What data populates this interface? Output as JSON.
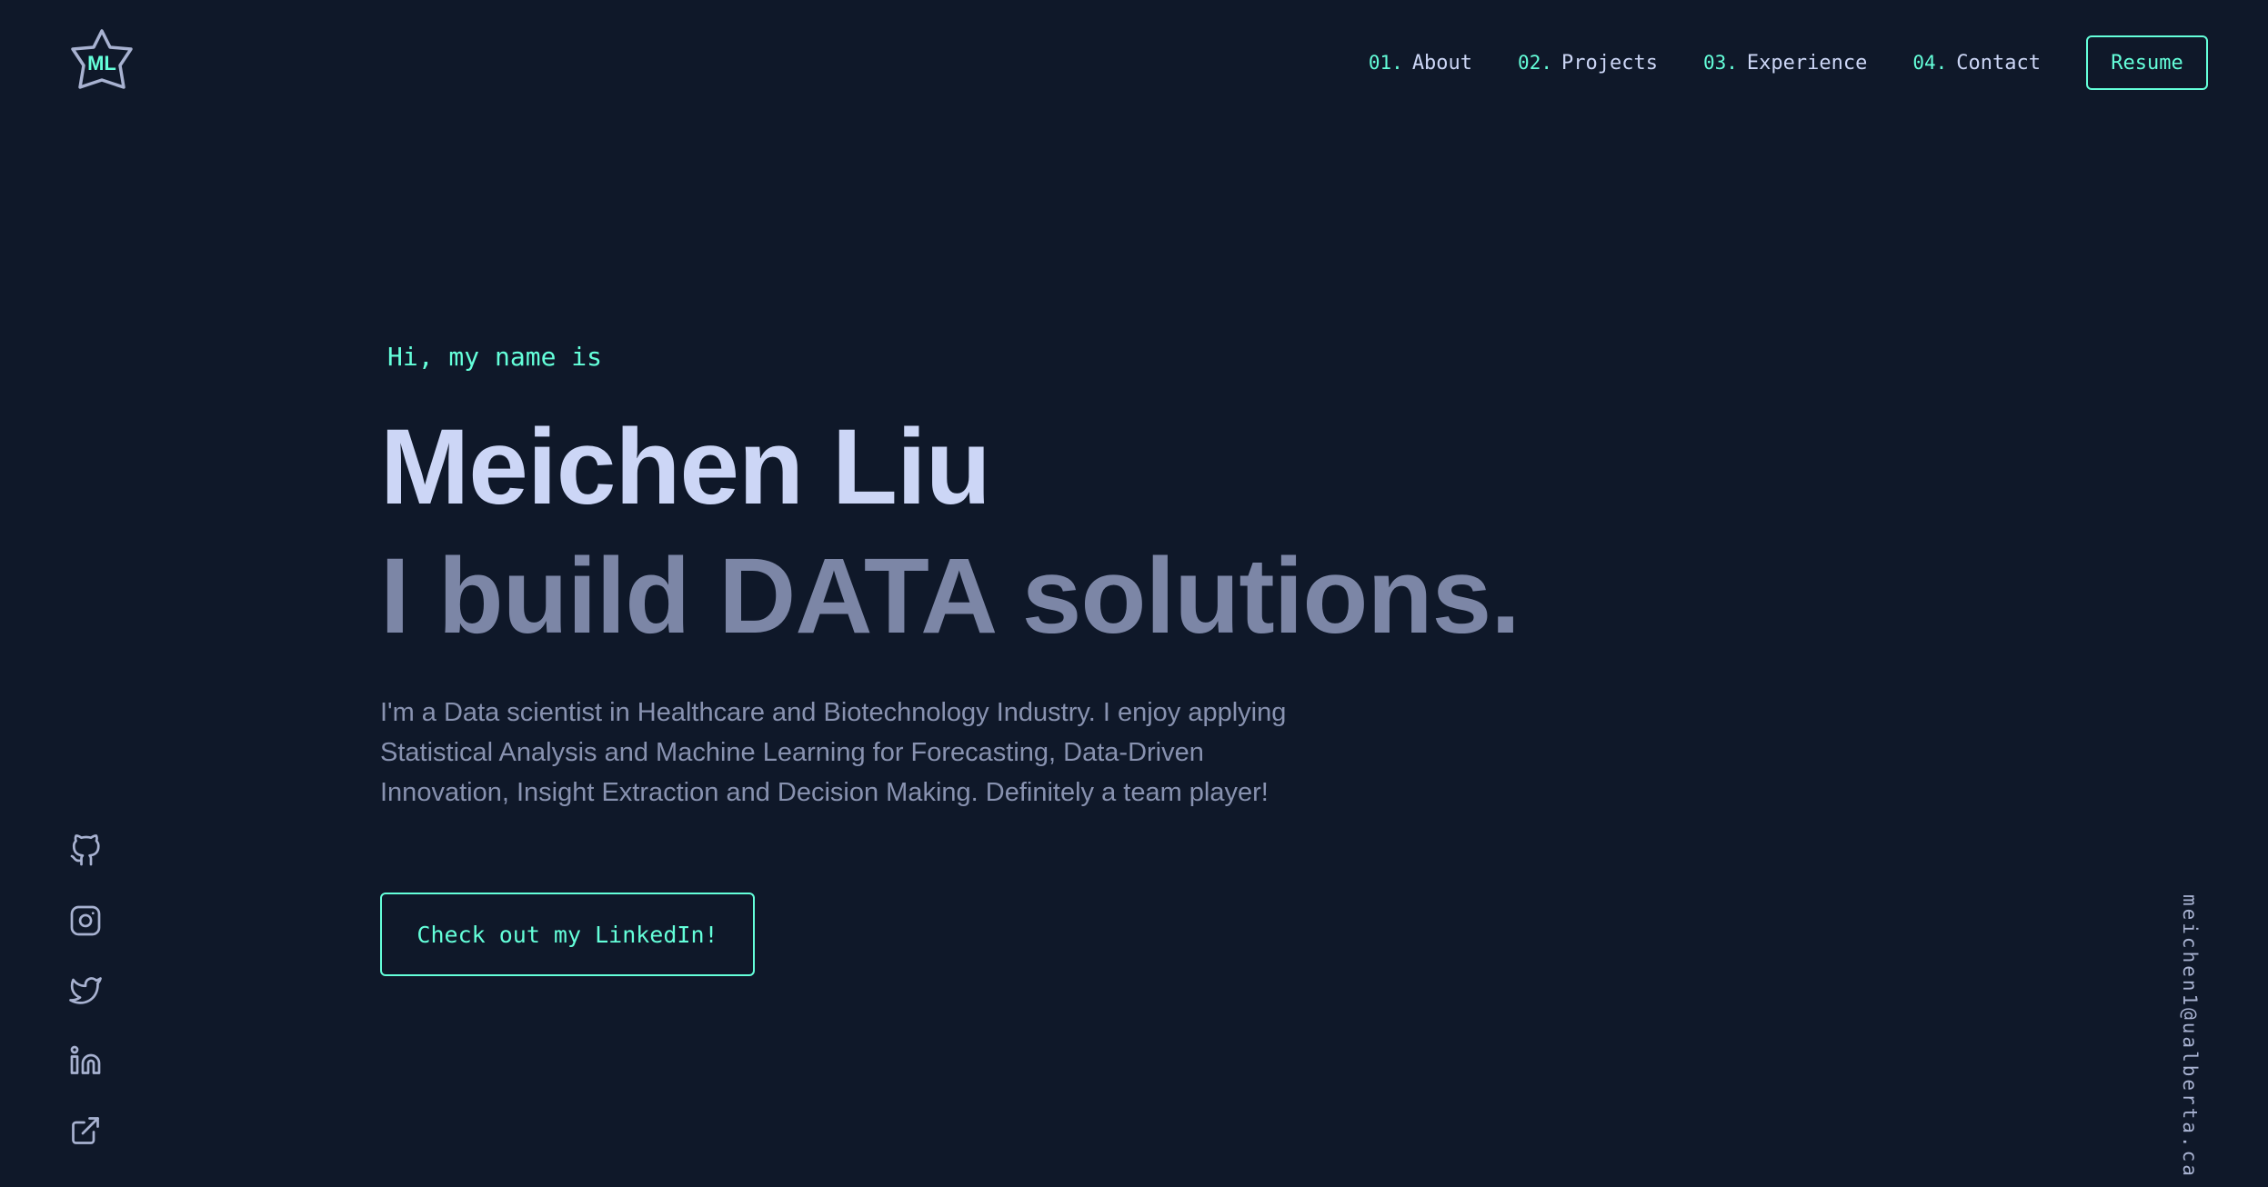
{
  "logo": {
    "text": "ML",
    "icon": "star-logo-icon"
  },
  "nav": {
    "items": [
      {
        "num": "01.",
        "label": "About"
      },
      {
        "num": "02.",
        "label": "Projects"
      },
      {
        "num": "03.",
        "label": "Experience"
      },
      {
        "num": "04.",
        "label": "Contact"
      }
    ],
    "resume_label": "Resume"
  },
  "hero": {
    "intro": "Hi, my name is",
    "name": "Meichen Liu",
    "tagline": "I build DATA solutions.",
    "description": "I'm a Data scientist in Healthcare and Biotechnology Industry. I enjoy applying Statistical Analysis and Machine Learning for Forecasting, Data-Driven Innovation, Insight Extraction and Decision Making. Definitely a team player!",
    "cta_label": "Check out my LinkedIn!"
  },
  "socials": [
    "github-icon",
    "instagram-icon",
    "twitter-icon",
    "linkedin-icon",
    "external-link-icon"
  ],
  "email": "meichen1@ualberta.ca",
  "colors": {
    "background": "#0f1829",
    "accent": "#64ffda",
    "heading": "#ccd6f6",
    "subheading": "#7c86a6",
    "body": "#8892b0"
  }
}
